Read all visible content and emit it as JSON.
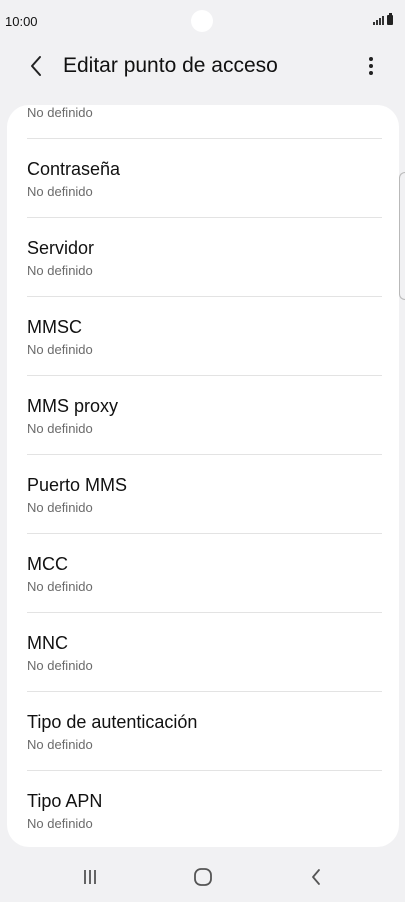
{
  "status_bar": {
    "time": "10:00"
  },
  "app_bar": {
    "title": "Editar punto de acceso"
  },
  "settings": {
    "partial_item": {
      "value": "No definido"
    },
    "items": [
      {
        "title": "Contraseña",
        "value": "No definido"
      },
      {
        "title": "Servidor",
        "value": "No definido"
      },
      {
        "title": "MMSC",
        "value": "No definido"
      },
      {
        "title": "MMS proxy",
        "value": "No definido"
      },
      {
        "title": "Puerto MMS",
        "value": "No definido"
      },
      {
        "title": "MCC",
        "value": "No definido"
      },
      {
        "title": "MNC",
        "value": "No definido"
      },
      {
        "title": "Tipo de autenticación",
        "value": "No definido"
      },
      {
        "title": "Tipo APN",
        "value": "No definido"
      }
    ]
  },
  "icons": {
    "back": "chevron-left-icon",
    "more": "more-vertical-icon",
    "nav_recents": "recents-icon",
    "nav_home": "home-icon",
    "nav_back": "back-icon"
  },
  "colors": {
    "background": "#f1f1f3",
    "card": "#ffffff",
    "secondary_text": "#6b6b6b"
  }
}
